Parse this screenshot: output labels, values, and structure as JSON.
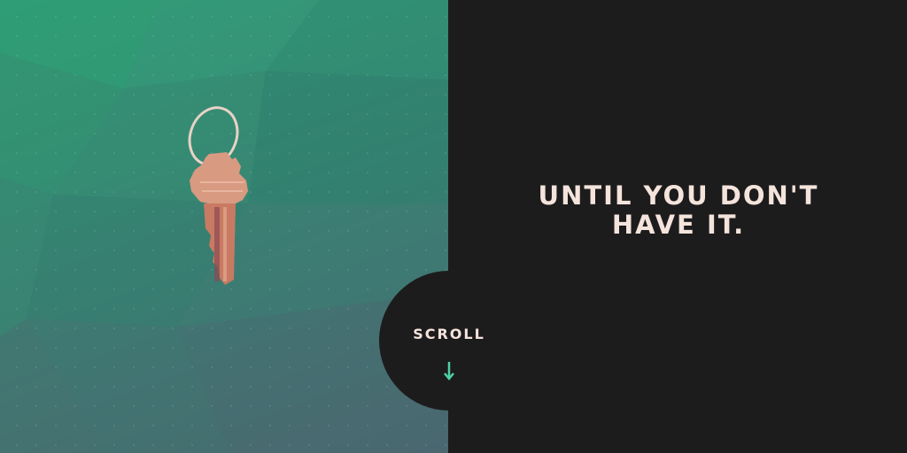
{
  "hero": {
    "headline_line1": "UNTIL YOU DON'T",
    "headline_line2": "HAVE IT.",
    "image_icon": "key-icon"
  },
  "scroll": {
    "label": "SCROLL",
    "icon": "arrow-down-icon"
  },
  "colors": {
    "panel_dark": "#1d1c1d",
    "text": "#f4e4dc",
    "accent": "#4fd1a5",
    "panel_green": "#2f9a74",
    "key_copper": "#d68a72"
  }
}
